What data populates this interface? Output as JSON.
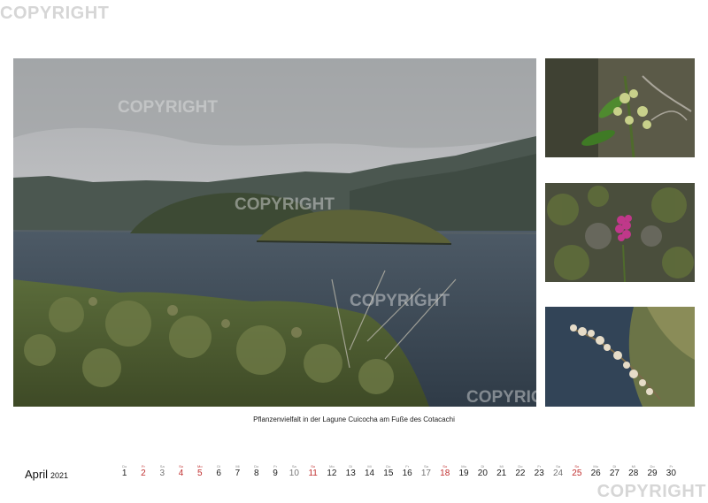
{
  "watermark": "COPYRIGHT",
  "caption": "Pflanzenvielfalt in der Lagune Cuicocha am Fuße des Cotacachi",
  "calendar": {
    "month": "April",
    "year": "2021",
    "days": [
      {
        "dow": "Do",
        "num": "1",
        "kind": "normal"
      },
      {
        "dow": "Fr",
        "num": "2",
        "kind": "red"
      },
      {
        "dow": "Sa",
        "num": "3",
        "kind": "sat"
      },
      {
        "dow": "So",
        "num": "4",
        "kind": "red"
      },
      {
        "dow": "Mo",
        "num": "5",
        "kind": "red"
      },
      {
        "dow": "Di",
        "num": "6",
        "kind": "normal"
      },
      {
        "dow": "Mi",
        "num": "7",
        "kind": "normal"
      },
      {
        "dow": "Do",
        "num": "8",
        "kind": "normal"
      },
      {
        "dow": "Fr",
        "num": "9",
        "kind": "normal"
      },
      {
        "dow": "Sa",
        "num": "10",
        "kind": "sat"
      },
      {
        "dow": "So",
        "num": "11",
        "kind": "red"
      },
      {
        "dow": "Mo",
        "num": "12",
        "kind": "normal"
      },
      {
        "dow": "Di",
        "num": "13",
        "kind": "normal"
      },
      {
        "dow": "Mi",
        "num": "14",
        "kind": "normal"
      },
      {
        "dow": "Do",
        "num": "15",
        "kind": "normal"
      },
      {
        "dow": "Fr",
        "num": "16",
        "kind": "normal"
      },
      {
        "dow": "Sa",
        "num": "17",
        "kind": "sat"
      },
      {
        "dow": "So",
        "num": "18",
        "kind": "red"
      },
      {
        "dow": "Mo",
        "num": "19",
        "kind": "normal"
      },
      {
        "dow": "Di",
        "num": "20",
        "kind": "normal"
      },
      {
        "dow": "Mi",
        "num": "21",
        "kind": "normal"
      },
      {
        "dow": "Do",
        "num": "22",
        "kind": "normal"
      },
      {
        "dow": "Fr",
        "num": "23",
        "kind": "normal"
      },
      {
        "dow": "Sa",
        "num": "24",
        "kind": "sat"
      },
      {
        "dow": "So",
        "num": "25",
        "kind": "red"
      },
      {
        "dow": "Mo",
        "num": "26",
        "kind": "normal"
      },
      {
        "dow": "Di",
        "num": "27",
        "kind": "normal"
      },
      {
        "dow": "Mi",
        "num": "28",
        "kind": "normal"
      },
      {
        "dow": "Do",
        "num": "29",
        "kind": "normal"
      },
      {
        "dow": "Fr",
        "num": "30",
        "kind": "normal"
      }
    ]
  },
  "colors": {
    "holiday_red": "#c03030",
    "saturday_gray": "#777777",
    "lake_blue": "#3c4a58",
    "sky_gray": "#b9bbbd"
  }
}
